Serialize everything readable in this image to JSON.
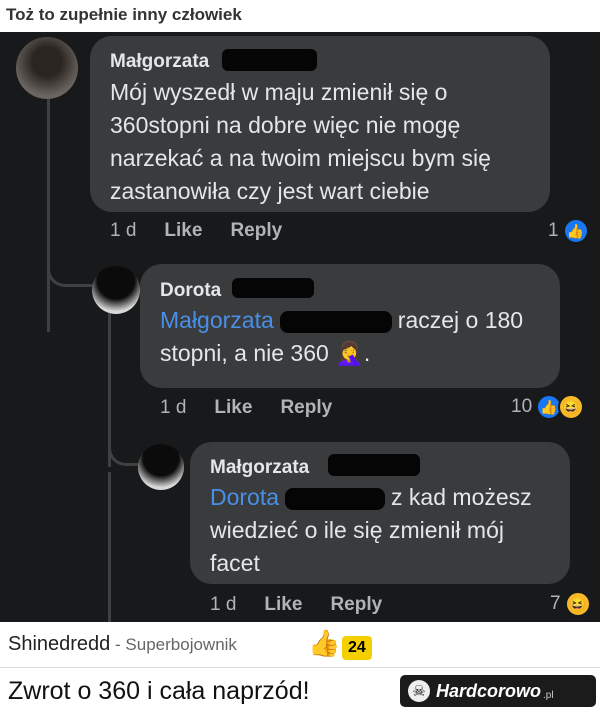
{
  "page": {
    "title": "Toż to zupełnie inny człowiek"
  },
  "comments": [
    {
      "author": "Małgorzata",
      "text": "Mój wyszedł w maju zmienił się o 360stopni na dobre więc nie mogę narzekać a na twoim miejscu bym się zastanowiła czy  jest wart ciebie",
      "time": "1 d",
      "like_label": "Like",
      "reply_label": "Reply",
      "reactions": "1"
    },
    {
      "author": "Dorota",
      "mention": "Małgorzata",
      "text_after_mention": "raczej o 180",
      "text_line2": "stopni, a nie 360",
      "emoji": "🤦‍♀️",
      "text_end": ".",
      "time": "1 d",
      "like_label": "Like",
      "reply_label": "Reply",
      "reactions": "10"
    },
    {
      "author": "Małgorzata",
      "mention": "Dorota",
      "text_after_mention": "z kad możesz",
      "text_line2": "wiedzieć o ile się zmienił mój",
      "text_line3": "facet",
      "time": "1 d",
      "like_label": "Like",
      "reply_label": "Reply",
      "reactions": "7"
    }
  ],
  "footer": {
    "username": "Shinedredd",
    "separator": " - ",
    "role": "Superbojownik",
    "thumb": "👍",
    "votes": "24",
    "caption": "Zwrot o 360 i cała naprzód!",
    "logo_text": "Hardcorowo",
    "logo_suffix": ".pl"
  },
  "icons": {
    "like": "👍",
    "haha": "😆",
    "skull": "☠"
  }
}
